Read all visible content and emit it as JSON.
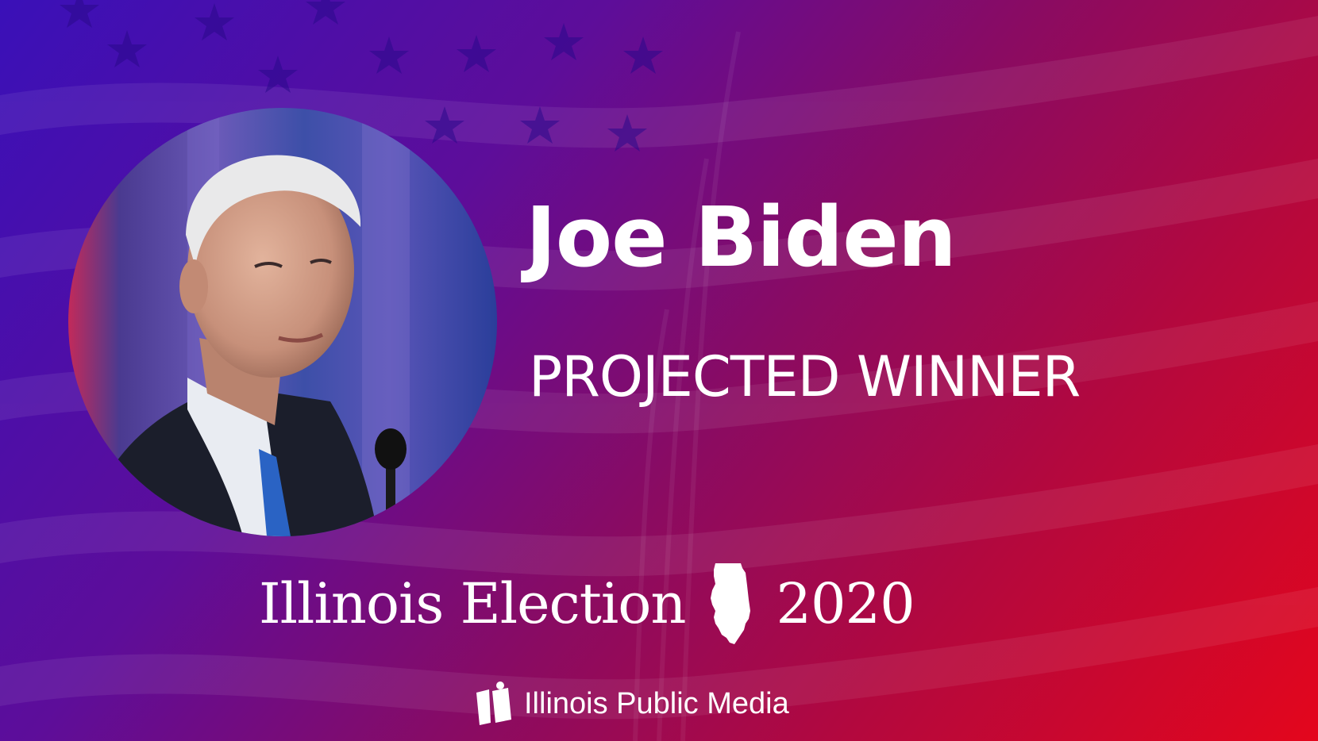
{
  "candidate": {
    "name": "Joe Biden",
    "status": "PROJECTED WINNER",
    "photo_icon": "candidate-portrait"
  },
  "election": {
    "title": "Illinois Election",
    "year": "2020",
    "state_icon": "illinois-state-outline-icon"
  },
  "brand": {
    "name": "Illinois Public Media",
    "logo_icon": "illinois-public-media-logo-icon"
  },
  "colors": {
    "gradient_blue": "#3a10b8",
    "gradient_purple": "#6a0c8c",
    "gradient_red": "#e4061c",
    "text": "#ffffff"
  }
}
